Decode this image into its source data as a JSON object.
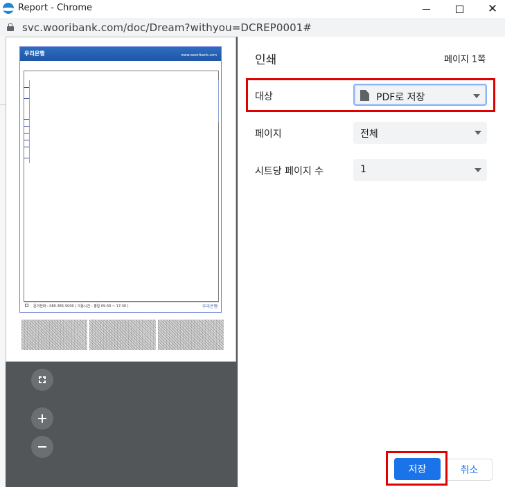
{
  "window": {
    "title": "Report - Chrome",
    "url": "svc.wooribank.com/doc/Dream?withyou=DCREP0001#"
  },
  "preview": {
    "doc_logo": "우리은행",
    "doc_url": "www.wooribank.com",
    "doc_footer_text": "문의전화 : 080-365-5000   ( 이용시간 : 평일 09:30 ~ 17:30 )",
    "doc_footer_logo": "우리은행"
  },
  "settings": {
    "title": "인쇄",
    "page_count": "페이지 1쪽",
    "destination": {
      "label": "대상",
      "value": "PDF로 저장"
    },
    "pages": {
      "label": "페이지",
      "value": "전체"
    },
    "pages_per_sheet": {
      "label": "시트당 페이지 수",
      "value": "1"
    }
  },
  "buttons": {
    "save": "저장",
    "cancel": "취소"
  },
  "colors": {
    "primary": "#1a73e8",
    "highlight": "#e00000",
    "preview_bg": "#525659"
  },
  "icons": [
    "chrome-logo-icon",
    "lock-icon",
    "document-icon",
    "fit-to-page-icon",
    "zoom-in-icon",
    "zoom-out-icon",
    "dropdown-caret-icon"
  ]
}
